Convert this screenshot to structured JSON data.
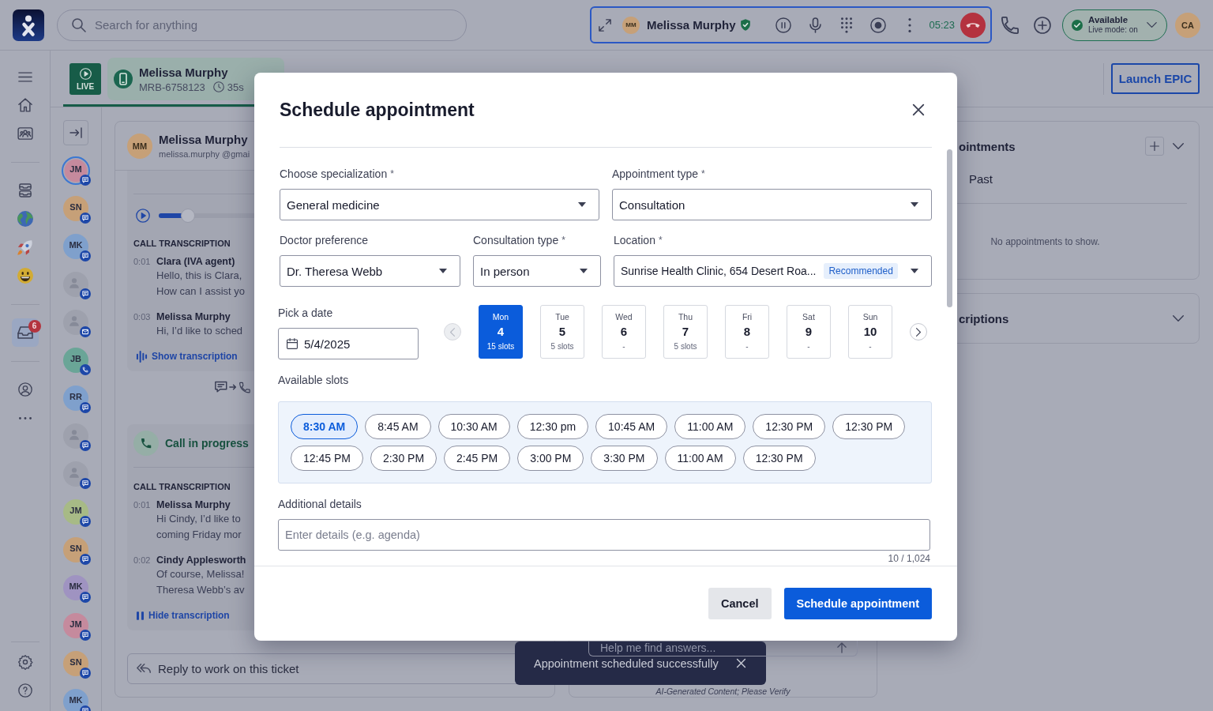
{
  "top_bar": {
    "search": {
      "placeholder": "Search for anything"
    },
    "active_call": {
      "initials": "MM",
      "name": "Melissa Murphy",
      "verified": true,
      "timer": "05:23"
    },
    "presence": {
      "label": "Available",
      "detail": "Live mode: on"
    },
    "user": {
      "initials": "CA"
    }
  },
  "nav_rail": {
    "items": [
      {
        "selected": false
      },
      {
        "selected": false
      },
      {
        "selected": false
      },
      {
        "selected": false
      },
      {
        "selected": false
      },
      {
        "selected": false
      },
      {
        "selected": false
      },
      {
        "selected": true,
        "badge": "6"
      },
      {
        "selected": false
      },
      {
        "selected": false
      },
      {
        "selected": false
      },
      {
        "selected": false
      }
    ]
  },
  "session_tabs": {
    "live": {
      "label": "LIVE"
    },
    "tabs": [
      {
        "name": "Melissa Murphy",
        "reference": "MRB-6758123",
        "duration": "35s",
        "selected": true
      }
    ],
    "launch_button": {
      "label": "Launch EPIC"
    }
  },
  "conversations": [
    {
      "initials": "JM",
      "color": "#c58a9d",
      "kind": "chat",
      "selected": true
    },
    {
      "initials": "SN",
      "color": "#c6a078",
      "kind": "chat",
      "selected": false
    },
    {
      "initials": "MK",
      "color": "#7fa0cc",
      "kind": "chat",
      "selected": false
    },
    {
      "kind": "chat",
      "selected": false
    },
    {
      "kind": "email",
      "selected": false
    },
    {
      "initials": "JB",
      "color": "#6aa597",
      "kind": "call",
      "selected": false
    },
    {
      "initials": "RR",
      "color": "#7fa0cc",
      "kind": "chat",
      "selected": false
    },
    {
      "kind": "chat",
      "selected": false
    },
    {
      "kind": "chat",
      "selected": false
    },
    {
      "initials": "JM",
      "color": "#a7ba86",
      "kind": "chat",
      "selected": false
    },
    {
      "initials": "SN",
      "color": "#c6a078",
      "kind": "chat",
      "selected": false
    },
    {
      "initials": "MK",
      "color": "#9f93c1",
      "kind": "chat",
      "selected": false
    },
    {
      "initials": "JM",
      "color": "#c58a9d",
      "kind": "chat",
      "selected": false
    },
    {
      "initials": "SN",
      "color": "#c6a078",
      "kind": "chat",
      "selected": false
    },
    {
      "initials": "MK",
      "color": "#7fa0cc",
      "kind": "chat",
      "selected": false
    }
  ],
  "ticket": {
    "contact": {
      "initials": "MM",
      "name": "Melissa Murphy",
      "email": "melissa.murphy @gmai"
    },
    "threads": [
      {
        "kind": "recording",
        "player": {
          "level": 0.08
        },
        "heading": "CALL TRANSCRIPTION",
        "entries": [
          {
            "time": "0:01",
            "speaker": "Clara (IVA agent)",
            "lines": [
              "Hello, this is Clara,",
              "How can I assist yo"
            ]
          },
          {
            "time": "0:03",
            "speaker": "Melissa Murphy",
            "lines": [
              "Hi, I’d like to sched"
            ]
          }
        ],
        "toggle": {
          "label": "Show transcription",
          "expanded": false
        }
      },
      {
        "kind": "live_call",
        "title": "Call in progress",
        "heading": "CALL TRANSCRIPTION",
        "entries": [
          {
            "time": "0:01",
            "speaker": "Melissa Murphy",
            "lines": [
              "Hi Cindy, I’d like to",
              "coming Friday mor"
            ]
          },
          {
            "time": "0:02",
            "speaker": "Cindy Applesworth",
            "lines": [
              "Of course, Melissa!",
              "Theresa Webb’s av"
            ]
          }
        ],
        "toggle": {
          "label": "Hide transcription",
          "expanded": true
        }
      }
    ],
    "reply": {
      "placeholder": "Reply to work on this ticket"
    }
  },
  "assistant": {
    "placeholder": "Help me find answers...",
    "disclaimer": "AI-Generated Content; Please Verify"
  },
  "side_panels": [
    {
      "title": "ointments",
      "expanded": true,
      "tabs": [
        {
          "label": "Past",
          "selected": false
        }
      ],
      "empty_message": "No appointments to show."
    },
    {
      "title": "criptions",
      "expanded": false
    }
  ],
  "modal": {
    "title": "Schedule appointment",
    "fields": [
      {
        "label": "Choose specialization",
        "required_mark": "*",
        "value": "General medicine"
      },
      {
        "label": "Appointment type",
        "required_mark": "*",
        "value": "Consultation"
      },
      {
        "label": "Doctor preference",
        "value": "Dr. Theresa Webb"
      },
      {
        "label": "Consultation type",
        "required_mark": "*",
        "value": "In person"
      },
      {
        "label": "Location",
        "required_mark": "*",
        "value": "Sunrise Health Clinic, 654 Desert Roa...",
        "tag": "Recommended"
      }
    ],
    "date_picker": {
      "label": "Pick a date",
      "value": "5/4/2025",
      "previous_disabled": true,
      "next_disabled": false,
      "days": [
        {
          "weekday": "Mon",
          "day": "4",
          "slots": "15 slots",
          "selected": true
        },
        {
          "weekday": "Tue",
          "day": "5",
          "slots": "5 slots",
          "selected": false
        },
        {
          "weekday": "Wed",
          "day": "6",
          "slots": "-",
          "selected": false
        },
        {
          "weekday": "Thu",
          "day": "7",
          "slots": "5 slots",
          "selected": false
        },
        {
          "weekday": "Fri",
          "day": "8",
          "slots": "-",
          "selected": false
        },
        {
          "weekday": "Sat",
          "day": "9",
          "slots": "-",
          "selected": false
        },
        {
          "weekday": "Sun",
          "day": "10",
          "slots": "-",
          "selected": false
        }
      ]
    },
    "slots": {
      "label": "Available slots",
      "items": [
        {
          "time": "8:30 AM",
          "selected": true
        },
        {
          "time": "8:45 AM",
          "selected": false
        },
        {
          "time": "10:30 AM",
          "selected": false
        },
        {
          "time": "12:30 pm",
          "selected": false
        },
        {
          "time": "10:45 AM",
          "selected": false
        },
        {
          "time": "11:00 AM",
          "selected": false
        },
        {
          "time": "12:30 PM",
          "selected": false
        },
        {
          "time": "12:30 PM",
          "selected": false
        },
        {
          "time": "12:45 PM",
          "selected": false
        },
        {
          "time": "2:30 PM",
          "selected": false
        },
        {
          "time": "2:45 PM",
          "selected": false
        },
        {
          "time": "3:00 PM",
          "selected": false
        },
        {
          "time": "3:30 PM",
          "selected": false
        },
        {
          "time": "11:00 AM",
          "selected": false
        },
        {
          "time": "12:30 PM",
          "selected": false
        }
      ]
    },
    "details": {
      "label": "Additional details",
      "placeholder": "Enter details (e.g. agenda)",
      "counter": "10 / 1,024"
    },
    "buttons": [
      {
        "label": "Cancel",
        "kind": "secondary"
      },
      {
        "label": "Schedule appointment",
        "kind": "primary"
      }
    ]
  },
  "toast": {
    "message": "Appointment scheduled successfully"
  }
}
